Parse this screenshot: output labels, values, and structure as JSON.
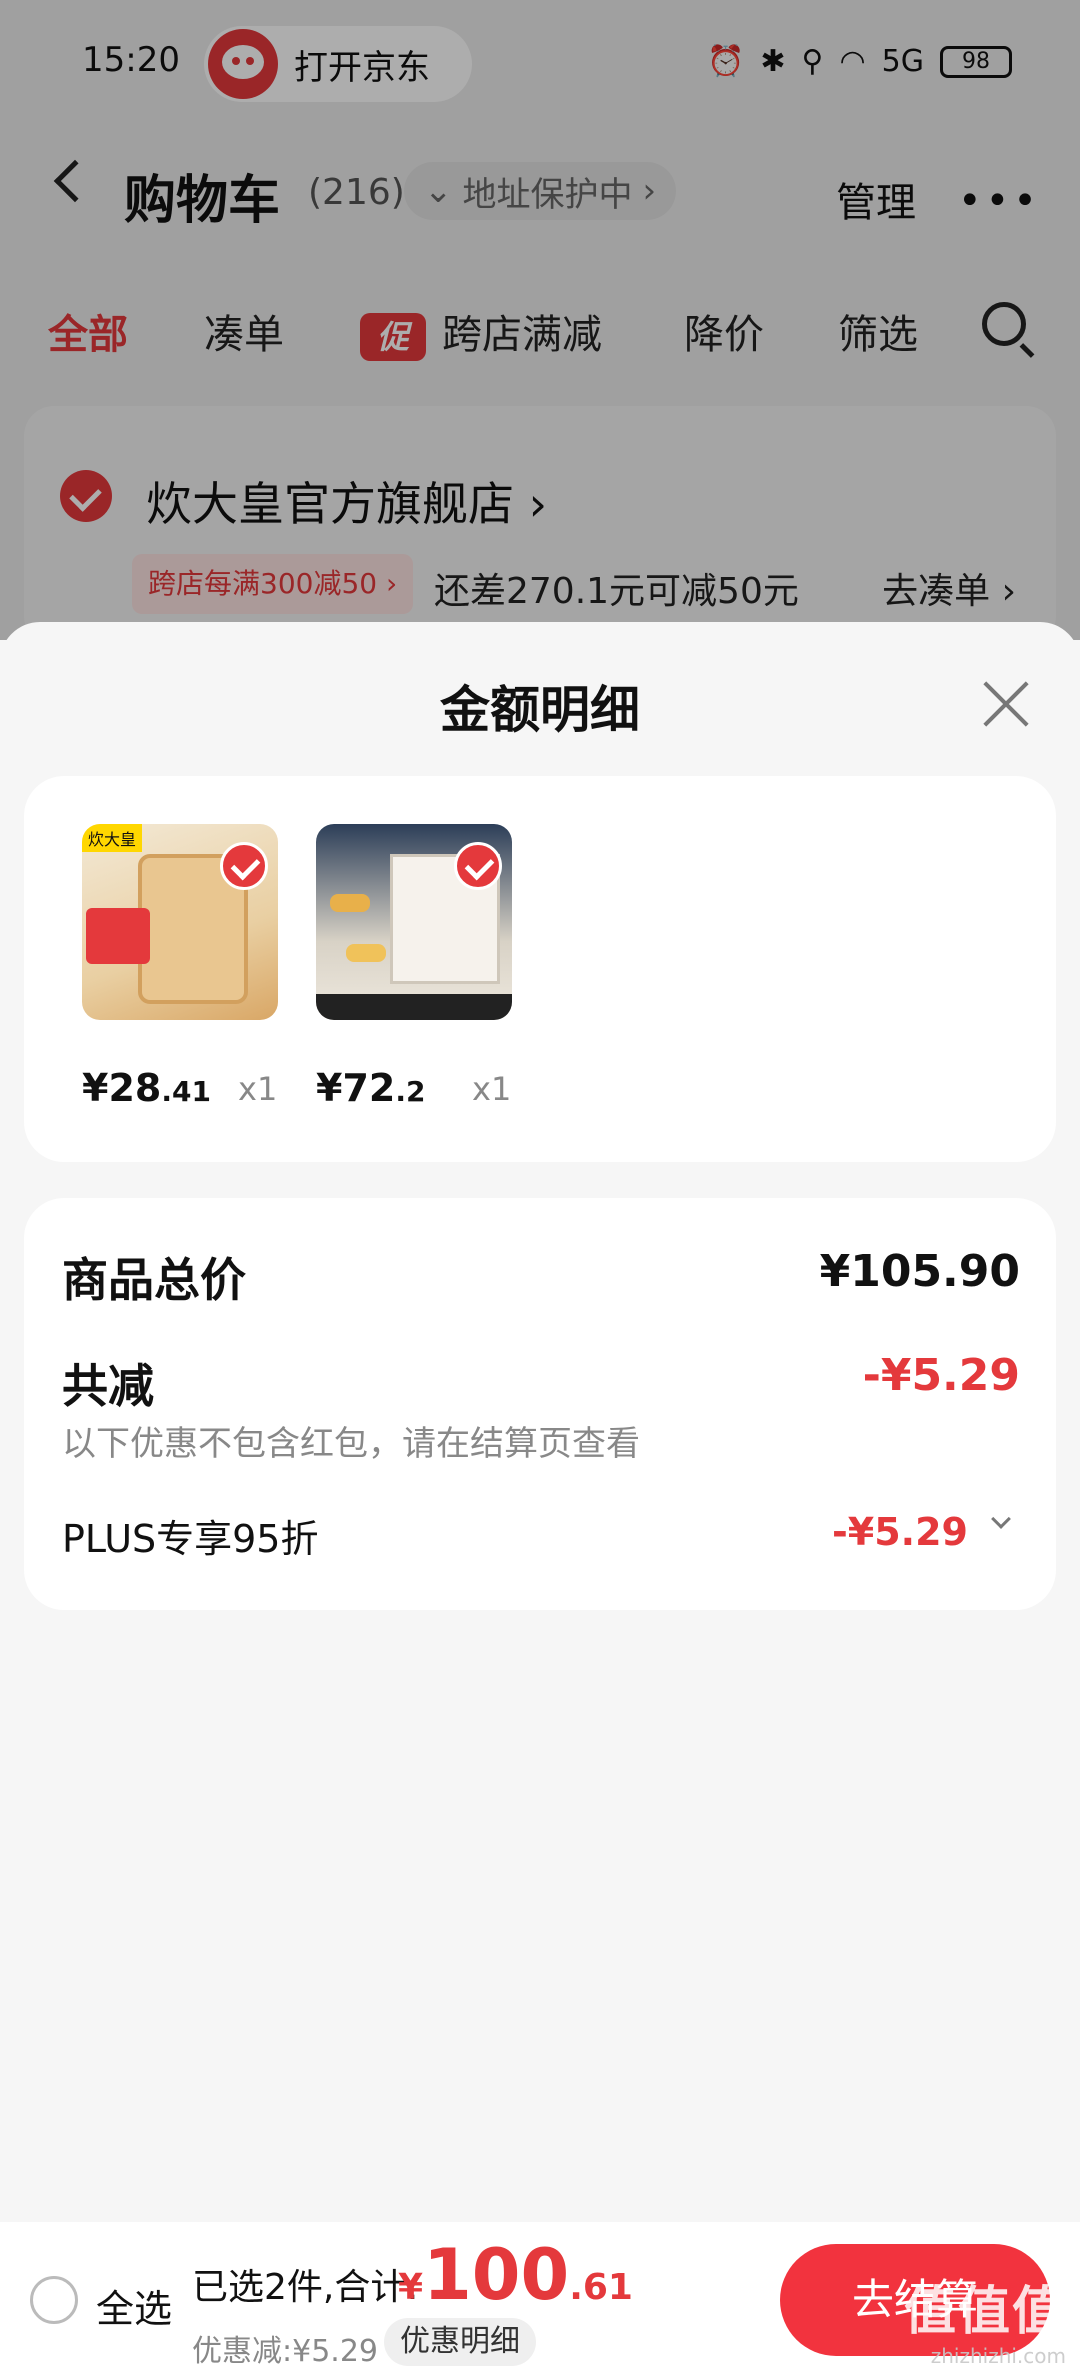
{
  "status_bar": {
    "time": "15:20",
    "open_app_label": "打开京东",
    "network": "5G",
    "battery": "98"
  },
  "cart_header": {
    "title": "购物车",
    "count": "(216)",
    "address_protect": "地址保护中",
    "manage": "管理"
  },
  "cart_tabs": {
    "all": "全部",
    "bundle": "凑单",
    "promo_badge": "促",
    "cross_store": "跨店满减",
    "price_drop": "降价",
    "filter": "筛选"
  },
  "store": {
    "name": "炊大皇官方旗舰店",
    "promo": "跨店每满300减50",
    "promo_hint": "还差270.1元可减50元",
    "go_add": "去凑单"
  },
  "sheet": {
    "title": "金额明细",
    "products": [
      {
        "price_int": "¥28",
        "price_dec": ".41",
        "qty": "x1",
        "img_brand": "炊大皇",
        "img_icon": "cutting-board-image"
      },
      {
        "price_int": "¥72",
        "price_dec": ".2",
        "qty": "x1",
        "img_icon": "shoe-rack-image"
      }
    ],
    "totals": {
      "subtotal_label": "商品总价",
      "subtotal_value": "¥105.90",
      "discount_label": "共减",
      "discount_value": "-¥5.29",
      "discount_note": "以下优惠不包含红包，请在结算页查看",
      "plus_label": "PLUS专享95折",
      "plus_value": "-¥5.29"
    }
  },
  "bottom_bar": {
    "select_all": "全选",
    "selected_summary": "已选2件,合计:",
    "total_currency": "¥",
    "total_int": "100",
    "total_dec": ".61",
    "discount_line": "优惠减:¥5.29",
    "discount_detail": "优惠明细",
    "checkout": "去结算",
    "watermark": "值值值",
    "watermark_url": "zhizhizhi.com"
  },
  "colors": {
    "accent": "#e4393c",
    "checkout": "#f2333e"
  }
}
